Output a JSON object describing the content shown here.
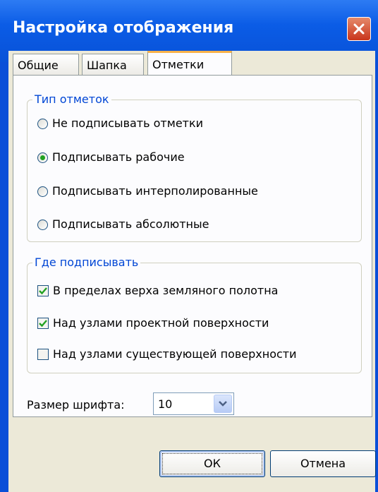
{
  "window": {
    "title": "Настройка отображения"
  },
  "tabs": [
    {
      "label": "Общие"
    },
    {
      "label": "Шапка"
    },
    {
      "label": "Отметки"
    }
  ],
  "mark_type": {
    "legend": "Тип отметок",
    "options": [
      {
        "label": "Не подписывать отметки",
        "selected": false
      },
      {
        "label": "Подписывать рабочие",
        "selected": true
      },
      {
        "label": "Подписывать интерполированные",
        "selected": false
      },
      {
        "label": "Подписывать абсолютные",
        "selected": false
      }
    ]
  },
  "where": {
    "legend": "Где подписывать",
    "options": [
      {
        "label": "В пределах верха земляного полотна",
        "checked": true
      },
      {
        "label": "Над узлами проектной поверхности",
        "checked": true
      },
      {
        "label": "Над узлами существующей поверхности",
        "checked": false
      }
    ]
  },
  "font_size": {
    "label": "Размер шрифта:",
    "value": "10"
  },
  "buttons": {
    "ok": "ОК",
    "cancel": "Отмена"
  },
  "colors": {
    "title_bar": "#0b5ce6",
    "group_legend": "#0046d5",
    "active_tab_accent": "#f8b24a",
    "check_mark": "#21a121"
  }
}
